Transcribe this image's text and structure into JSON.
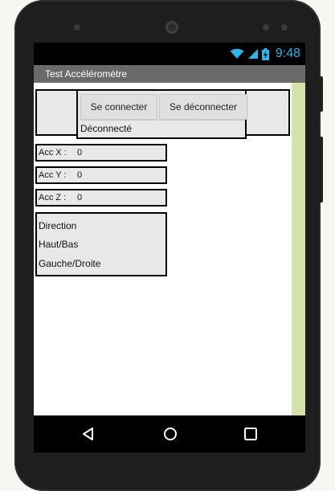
{
  "status_bar": {
    "time": "9:48",
    "icons": [
      "wifi-icon",
      "signal-icon",
      "battery-charging-icon"
    ]
  },
  "app": {
    "title": "Test Accéléromètre"
  },
  "connection": {
    "connect_label": "Se connecter",
    "disconnect_label": "Se déconnecter",
    "status": "Déconnecté"
  },
  "accelerometer": {
    "x_label": "Acc X :",
    "x_value": "0",
    "y_label": "Acc Y :",
    "y_value": "0",
    "z_label": "Acc Z :",
    "z_value": "0"
  },
  "direction": {
    "title": "Direction",
    "vertical": "Haut/Bas",
    "horizontal": "Gauche/Droite"
  },
  "nav_bar": {
    "icons": [
      "back-icon",
      "home-icon",
      "recents-icon"
    ]
  },
  "colors": {
    "status_clock": "#2fb4e9",
    "title_bar": "#6a6a6a",
    "side_strip": "#d5e3ab"
  }
}
